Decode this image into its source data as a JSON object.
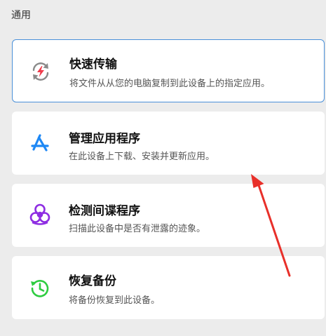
{
  "section": {
    "label": "通用"
  },
  "cards": [
    {
      "title": "快速传输",
      "description": "将文件从从您的电脑复制到此设备上的指定应用。",
      "icon": "sync-lightning-icon",
      "selected": true
    },
    {
      "title": "管理应用程序",
      "description": "在此设备上下载、安装并更新应用。",
      "icon": "app-store-icon"
    },
    {
      "title": "检测间谍程序",
      "description": "扫描此设备中是否有泄露的迹象。",
      "icon": "biohazard-icon"
    },
    {
      "title": "恢复备份",
      "description": "将备份恢复到此设备。",
      "icon": "restore-clock-icon"
    }
  ],
  "colors": {
    "selected_border": "#4a90d9",
    "app_store_blue": "#1e88f5",
    "biohazard_purple": "#8e2de2",
    "restore_green": "#2ecc40",
    "lightning_red": "#f03a4a",
    "annotation_arrow": "#e8302a"
  }
}
